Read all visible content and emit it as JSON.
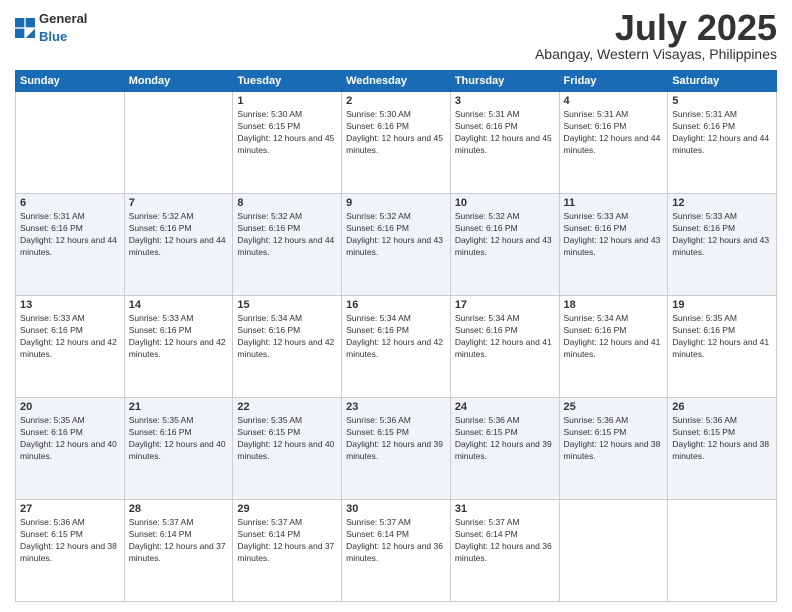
{
  "header": {
    "logo_general": "General",
    "logo_blue": "Blue",
    "month_title": "July 2025",
    "location": "Abangay, Western Visayas, Philippines"
  },
  "weekdays": [
    "Sunday",
    "Monday",
    "Tuesday",
    "Wednesday",
    "Thursday",
    "Friday",
    "Saturday"
  ],
  "weeks": [
    [
      {
        "day": "",
        "sunrise": "",
        "sunset": "",
        "daylight": ""
      },
      {
        "day": "",
        "sunrise": "",
        "sunset": "",
        "daylight": ""
      },
      {
        "day": "1",
        "sunrise": "Sunrise: 5:30 AM",
        "sunset": "Sunset: 6:15 PM",
        "daylight": "Daylight: 12 hours and 45 minutes."
      },
      {
        "day": "2",
        "sunrise": "Sunrise: 5:30 AM",
        "sunset": "Sunset: 6:16 PM",
        "daylight": "Daylight: 12 hours and 45 minutes."
      },
      {
        "day": "3",
        "sunrise": "Sunrise: 5:31 AM",
        "sunset": "Sunset: 6:16 PM",
        "daylight": "Daylight: 12 hours and 45 minutes."
      },
      {
        "day": "4",
        "sunrise": "Sunrise: 5:31 AM",
        "sunset": "Sunset: 6:16 PM",
        "daylight": "Daylight: 12 hours and 44 minutes."
      },
      {
        "day": "5",
        "sunrise": "Sunrise: 5:31 AM",
        "sunset": "Sunset: 6:16 PM",
        "daylight": "Daylight: 12 hours and 44 minutes."
      }
    ],
    [
      {
        "day": "6",
        "sunrise": "Sunrise: 5:31 AM",
        "sunset": "Sunset: 6:16 PM",
        "daylight": "Daylight: 12 hours and 44 minutes."
      },
      {
        "day": "7",
        "sunrise": "Sunrise: 5:32 AM",
        "sunset": "Sunset: 6:16 PM",
        "daylight": "Daylight: 12 hours and 44 minutes."
      },
      {
        "day": "8",
        "sunrise": "Sunrise: 5:32 AM",
        "sunset": "Sunset: 6:16 PM",
        "daylight": "Daylight: 12 hours and 44 minutes."
      },
      {
        "day": "9",
        "sunrise": "Sunrise: 5:32 AM",
        "sunset": "Sunset: 6:16 PM",
        "daylight": "Daylight: 12 hours and 43 minutes."
      },
      {
        "day": "10",
        "sunrise": "Sunrise: 5:32 AM",
        "sunset": "Sunset: 6:16 PM",
        "daylight": "Daylight: 12 hours and 43 minutes."
      },
      {
        "day": "11",
        "sunrise": "Sunrise: 5:33 AM",
        "sunset": "Sunset: 6:16 PM",
        "daylight": "Daylight: 12 hours and 43 minutes."
      },
      {
        "day": "12",
        "sunrise": "Sunrise: 5:33 AM",
        "sunset": "Sunset: 6:16 PM",
        "daylight": "Daylight: 12 hours and 43 minutes."
      }
    ],
    [
      {
        "day": "13",
        "sunrise": "Sunrise: 5:33 AM",
        "sunset": "Sunset: 6:16 PM",
        "daylight": "Daylight: 12 hours and 42 minutes."
      },
      {
        "day": "14",
        "sunrise": "Sunrise: 5:33 AM",
        "sunset": "Sunset: 6:16 PM",
        "daylight": "Daylight: 12 hours and 42 minutes."
      },
      {
        "day": "15",
        "sunrise": "Sunrise: 5:34 AM",
        "sunset": "Sunset: 6:16 PM",
        "daylight": "Daylight: 12 hours and 42 minutes."
      },
      {
        "day": "16",
        "sunrise": "Sunrise: 5:34 AM",
        "sunset": "Sunset: 6:16 PM",
        "daylight": "Daylight: 12 hours and 42 minutes."
      },
      {
        "day": "17",
        "sunrise": "Sunrise: 5:34 AM",
        "sunset": "Sunset: 6:16 PM",
        "daylight": "Daylight: 12 hours and 41 minutes."
      },
      {
        "day": "18",
        "sunrise": "Sunrise: 5:34 AM",
        "sunset": "Sunset: 6:16 PM",
        "daylight": "Daylight: 12 hours and 41 minutes."
      },
      {
        "day": "19",
        "sunrise": "Sunrise: 5:35 AM",
        "sunset": "Sunset: 6:16 PM",
        "daylight": "Daylight: 12 hours and 41 minutes."
      }
    ],
    [
      {
        "day": "20",
        "sunrise": "Sunrise: 5:35 AM",
        "sunset": "Sunset: 6:16 PM",
        "daylight": "Daylight: 12 hours and 40 minutes."
      },
      {
        "day": "21",
        "sunrise": "Sunrise: 5:35 AM",
        "sunset": "Sunset: 6:16 PM",
        "daylight": "Daylight: 12 hours and 40 minutes."
      },
      {
        "day": "22",
        "sunrise": "Sunrise: 5:35 AM",
        "sunset": "Sunset: 6:15 PM",
        "daylight": "Daylight: 12 hours and 40 minutes."
      },
      {
        "day": "23",
        "sunrise": "Sunrise: 5:36 AM",
        "sunset": "Sunset: 6:15 PM",
        "daylight": "Daylight: 12 hours and 39 minutes."
      },
      {
        "day": "24",
        "sunrise": "Sunrise: 5:36 AM",
        "sunset": "Sunset: 6:15 PM",
        "daylight": "Daylight: 12 hours and 39 minutes."
      },
      {
        "day": "25",
        "sunrise": "Sunrise: 5:36 AM",
        "sunset": "Sunset: 6:15 PM",
        "daylight": "Daylight: 12 hours and 38 minutes."
      },
      {
        "day": "26",
        "sunrise": "Sunrise: 5:36 AM",
        "sunset": "Sunset: 6:15 PM",
        "daylight": "Daylight: 12 hours and 38 minutes."
      }
    ],
    [
      {
        "day": "27",
        "sunrise": "Sunrise: 5:36 AM",
        "sunset": "Sunset: 6:15 PM",
        "daylight": "Daylight: 12 hours and 38 minutes."
      },
      {
        "day": "28",
        "sunrise": "Sunrise: 5:37 AM",
        "sunset": "Sunset: 6:14 PM",
        "daylight": "Daylight: 12 hours and 37 minutes."
      },
      {
        "day": "29",
        "sunrise": "Sunrise: 5:37 AM",
        "sunset": "Sunset: 6:14 PM",
        "daylight": "Daylight: 12 hours and 37 minutes."
      },
      {
        "day": "30",
        "sunrise": "Sunrise: 5:37 AM",
        "sunset": "Sunset: 6:14 PM",
        "daylight": "Daylight: 12 hours and 36 minutes."
      },
      {
        "day": "31",
        "sunrise": "Sunrise: 5:37 AM",
        "sunset": "Sunset: 6:14 PM",
        "daylight": "Daylight: 12 hours and 36 minutes."
      },
      {
        "day": "",
        "sunrise": "",
        "sunset": "",
        "daylight": ""
      },
      {
        "day": "",
        "sunrise": "",
        "sunset": "",
        "daylight": ""
      }
    ]
  ]
}
